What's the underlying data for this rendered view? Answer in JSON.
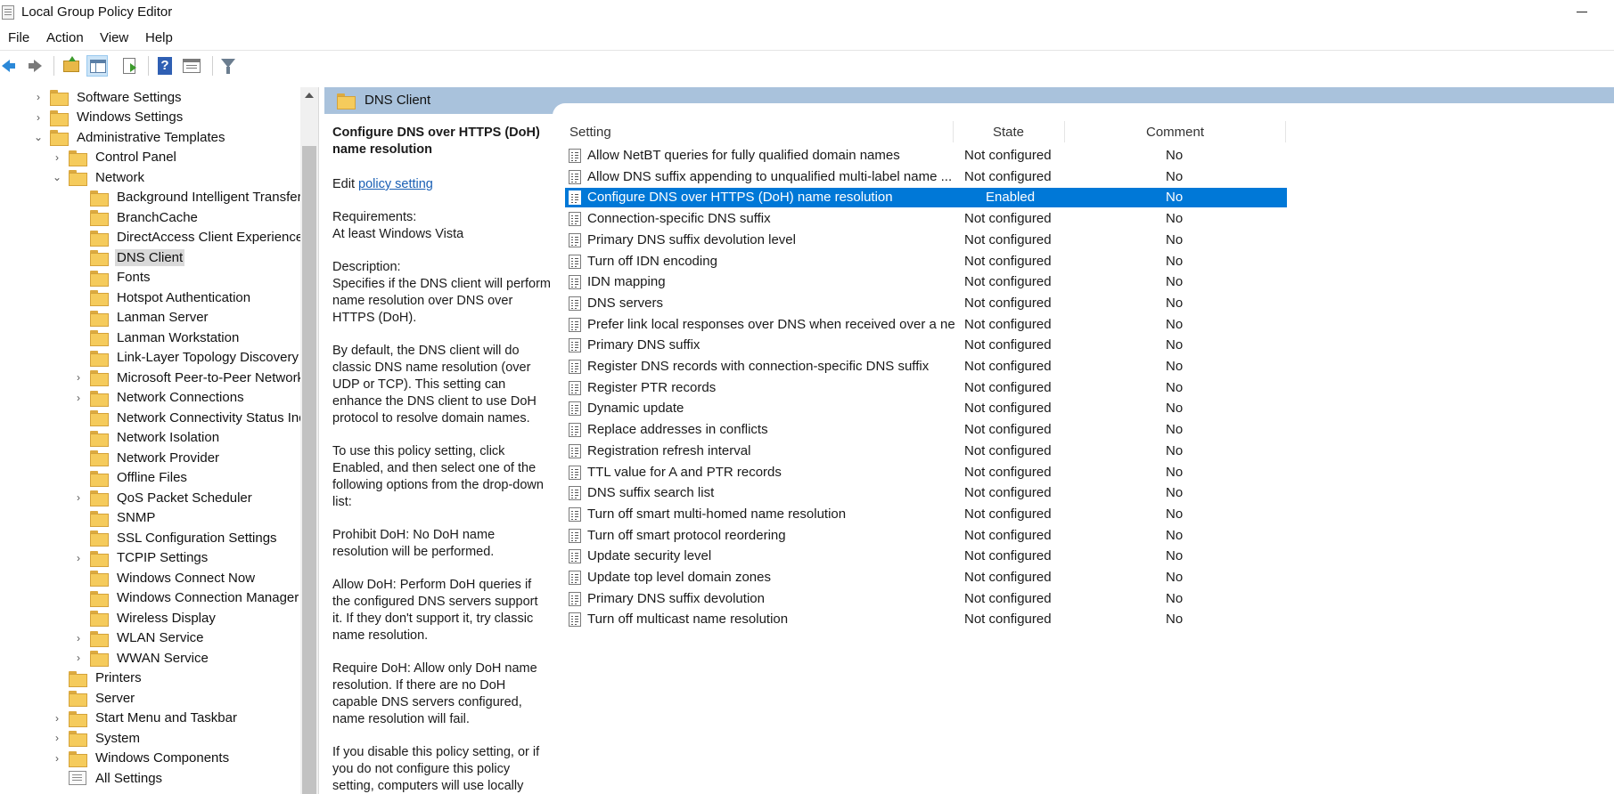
{
  "window": {
    "title": "Local Group Policy Editor"
  },
  "menu": [
    "File",
    "Action",
    "View",
    "Help"
  ],
  "tree": {
    "items": [
      {
        "label": "Software Settings",
        "level": 1,
        "expander": "collapsed",
        "icon": "folder"
      },
      {
        "label": "Windows Settings",
        "level": 1,
        "expander": "collapsed",
        "icon": "folder"
      },
      {
        "label": "Administrative Templates",
        "level": 1,
        "expander": "expanded",
        "icon": "folder"
      },
      {
        "label": "Control Panel",
        "level": 2,
        "expander": "collapsed",
        "icon": "folder"
      },
      {
        "label": "Network",
        "level": 2,
        "expander": "expanded",
        "icon": "folder"
      },
      {
        "label": "Background Intelligent Transfer",
        "level": 3,
        "expander": "none",
        "icon": "folder"
      },
      {
        "label": "BranchCache",
        "level": 3,
        "expander": "none",
        "icon": "folder"
      },
      {
        "label": "DirectAccess Client Experience Se",
        "level": 3,
        "expander": "none",
        "icon": "folder"
      },
      {
        "label": "DNS Client",
        "level": 3,
        "expander": "none",
        "icon": "folder",
        "selected": true
      },
      {
        "label": "Fonts",
        "level": 3,
        "expander": "none",
        "icon": "folder"
      },
      {
        "label": "Hotspot Authentication",
        "level": 3,
        "expander": "none",
        "icon": "folder"
      },
      {
        "label": "Lanman Server",
        "level": 3,
        "expander": "none",
        "icon": "folder"
      },
      {
        "label": "Lanman Workstation",
        "level": 3,
        "expander": "none",
        "icon": "folder"
      },
      {
        "label": "Link-Layer Topology Discovery",
        "level": 3,
        "expander": "none",
        "icon": "folder"
      },
      {
        "label": "Microsoft Peer-to-Peer Network",
        "level": 3,
        "expander": "collapsed",
        "icon": "folder"
      },
      {
        "label": "Network Connections",
        "level": 3,
        "expander": "collapsed",
        "icon": "folder"
      },
      {
        "label": "Network Connectivity Status Ind",
        "level": 3,
        "expander": "none",
        "icon": "folder"
      },
      {
        "label": "Network Isolation",
        "level": 3,
        "expander": "none",
        "icon": "folder"
      },
      {
        "label": "Network Provider",
        "level": 3,
        "expander": "none",
        "icon": "folder"
      },
      {
        "label": "Offline Files",
        "level": 3,
        "expander": "none",
        "icon": "folder"
      },
      {
        "label": "QoS Packet Scheduler",
        "level": 3,
        "expander": "collapsed",
        "icon": "folder"
      },
      {
        "label": "SNMP",
        "level": 3,
        "expander": "none",
        "icon": "folder"
      },
      {
        "label": "SSL Configuration Settings",
        "level": 3,
        "expander": "none",
        "icon": "folder"
      },
      {
        "label": "TCPIP Settings",
        "level": 3,
        "expander": "collapsed",
        "icon": "folder"
      },
      {
        "label": "Windows Connect Now",
        "level": 3,
        "expander": "none",
        "icon": "folder"
      },
      {
        "label": "Windows Connection Manager",
        "level": 3,
        "expander": "none",
        "icon": "folder"
      },
      {
        "label": "Wireless Display",
        "level": 3,
        "expander": "none",
        "icon": "folder"
      },
      {
        "label": "WLAN Service",
        "level": 3,
        "expander": "collapsed",
        "icon": "folder"
      },
      {
        "label": "WWAN Service",
        "level": 3,
        "expander": "collapsed",
        "icon": "folder"
      },
      {
        "label": "Printers",
        "level": 2,
        "expander": "none",
        "icon": "folder"
      },
      {
        "label": "Server",
        "level": 2,
        "expander": "none",
        "icon": "folder"
      },
      {
        "label": "Start Menu and Taskbar",
        "level": 2,
        "expander": "collapsed",
        "icon": "folder"
      },
      {
        "label": "System",
        "level": 2,
        "expander": "collapsed",
        "icon": "folder"
      },
      {
        "label": "Windows Components",
        "level": 2,
        "expander": "collapsed",
        "icon": "folder"
      },
      {
        "label": "All Settings",
        "level": 2,
        "expander": "none",
        "icon": "all-settings"
      }
    ]
  },
  "right_header": {
    "title": "DNS Client"
  },
  "description": {
    "title": "Configure DNS over HTTPS (DoH) name resolution",
    "edit_prefix": "Edit",
    "edit_link": "policy setting",
    "requirements_label": "Requirements:",
    "requirements_value": "At least Windows Vista",
    "description_label": "Description:",
    "paragraphs": [
      "Specifies if the DNS client will perform name resolution over DNS over HTTPS (DoH).",
      "By default, the DNS client will do classic DNS name resolution (over UDP or TCP). This setting can enhance the DNS client to use DoH protocol to resolve domain names.",
      "To use this policy setting, click Enabled, and then select one of the following options from the drop-down list:",
      "Prohibit DoH: No DoH name resolution will be performed.",
      "Allow DoH: Perform DoH queries if the configured DNS servers support it. If they don't support it, try classic name resolution.",
      "Require DoH: Allow only DoH name resolution. If there are no DoH capable DNS servers configured, name resolution will fail.",
      "If you disable this policy setting, or if you do not configure this policy setting, computers will use locally"
    ]
  },
  "settings_table": {
    "columns": [
      "Setting",
      "State",
      "Comment"
    ],
    "rows": [
      {
        "setting": "Allow NetBT queries for fully qualified domain names",
        "state": "Not configured",
        "comment": "No"
      },
      {
        "setting": "Allow DNS suffix appending to unqualified multi-label name ...",
        "state": "Not configured",
        "comment": "No"
      },
      {
        "setting": "Configure DNS over HTTPS (DoH) name resolution",
        "state": "Enabled",
        "comment": "No",
        "selected": true
      },
      {
        "setting": "Connection-specific DNS suffix",
        "state": "Not configured",
        "comment": "No"
      },
      {
        "setting": "Primary DNS suffix devolution level",
        "state": "Not configured",
        "comment": "No"
      },
      {
        "setting": "Turn off IDN encoding",
        "state": "Not configured",
        "comment": "No"
      },
      {
        "setting": "IDN mapping",
        "state": "Not configured",
        "comment": "No"
      },
      {
        "setting": "DNS servers",
        "state": "Not configured",
        "comment": "No"
      },
      {
        "setting": "Prefer link local responses over DNS when received over a net...",
        "state": "Not configured",
        "comment": "No"
      },
      {
        "setting": "Primary DNS suffix",
        "state": "Not configured",
        "comment": "No"
      },
      {
        "setting": "Register DNS records with connection-specific DNS suffix",
        "state": "Not configured",
        "comment": "No"
      },
      {
        "setting": "Register PTR records",
        "state": "Not configured",
        "comment": "No"
      },
      {
        "setting": "Dynamic update",
        "state": "Not configured",
        "comment": "No"
      },
      {
        "setting": "Replace addresses in conflicts",
        "state": "Not configured",
        "comment": "No"
      },
      {
        "setting": "Registration refresh interval",
        "state": "Not configured",
        "comment": "No"
      },
      {
        "setting": "TTL value for A and PTR records",
        "state": "Not configured",
        "comment": "No"
      },
      {
        "setting": "DNS suffix search list",
        "state": "Not configured",
        "comment": "No"
      },
      {
        "setting": "Turn off smart multi-homed name resolution",
        "state": "Not configured",
        "comment": "No"
      },
      {
        "setting": "Turn off smart protocol reordering",
        "state": "Not configured",
        "comment": "No"
      },
      {
        "setting": "Update security level",
        "state": "Not configured",
        "comment": "No"
      },
      {
        "setting": "Update top level domain zones",
        "state": "Not configured",
        "comment": "No"
      },
      {
        "setting": "Primary DNS suffix devolution",
        "state": "Not configured",
        "comment": "No"
      },
      {
        "setting": "Turn off multicast name resolution",
        "state": "Not configured",
        "comment": "No"
      }
    ]
  },
  "colors": {
    "selection": "#0078d7",
    "header_band": "#a9c2dc",
    "tree_selection": "#d9d9d9",
    "link": "#1a5fb4"
  }
}
